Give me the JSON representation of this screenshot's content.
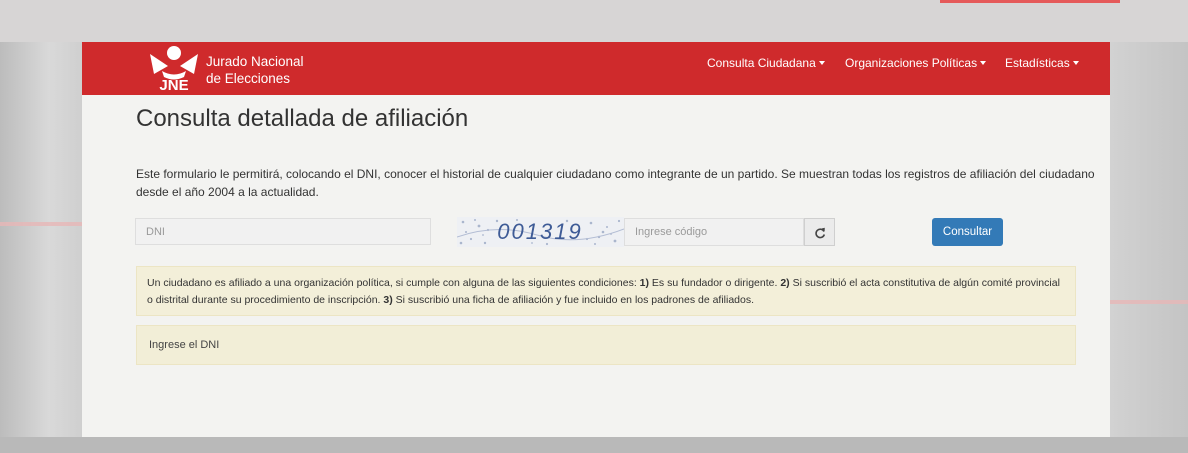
{
  "header": {
    "logo_abbr": "JNE",
    "logo_line1": "Jurado Nacional",
    "logo_line2": "de Elecciones",
    "nav": [
      {
        "label": "Consulta Ciudadana"
      },
      {
        "label": "Organizaciones Políticas"
      },
      {
        "label": "Estadísticas"
      }
    ]
  },
  "main": {
    "title": "Consulta detallada de afiliación",
    "intro": "Este formulario le permitirá, colocando el DNI, conocer el historial de cualquier ciudadano como integrante de un partido. Se muestran todas los registros de afiliación del ciudadano desde el año 2004 a la actualidad.",
    "form": {
      "dni_placeholder": "DNI",
      "dni_value": "",
      "captcha_text": "001319",
      "code_placeholder": "Ingrese código",
      "code_value": "",
      "refresh_icon": "refresh-icon",
      "submit_label": "Consultar"
    },
    "info": {
      "intro": "Un ciudadano es afiliado a una organización política, si cumple con alguna de las siguientes condiciones: ",
      "n1": "1)",
      "c1": " Es su fundador o dirigente. ",
      "n2": "2)",
      "c2": " Si suscribió el acta constitutiva de algún comité provincial o distrital durante su procedimiento de inscripción. ",
      "n3": "3)",
      "c3": " Si suscribió una ficha de afiliación y fue incluido en los padrones de afiliados."
    },
    "message": "Ingrese el DNI"
  },
  "colors": {
    "navbar": "#cf2a2c",
    "button": "#337ab7",
    "alert_bg": "#f3efd9"
  }
}
